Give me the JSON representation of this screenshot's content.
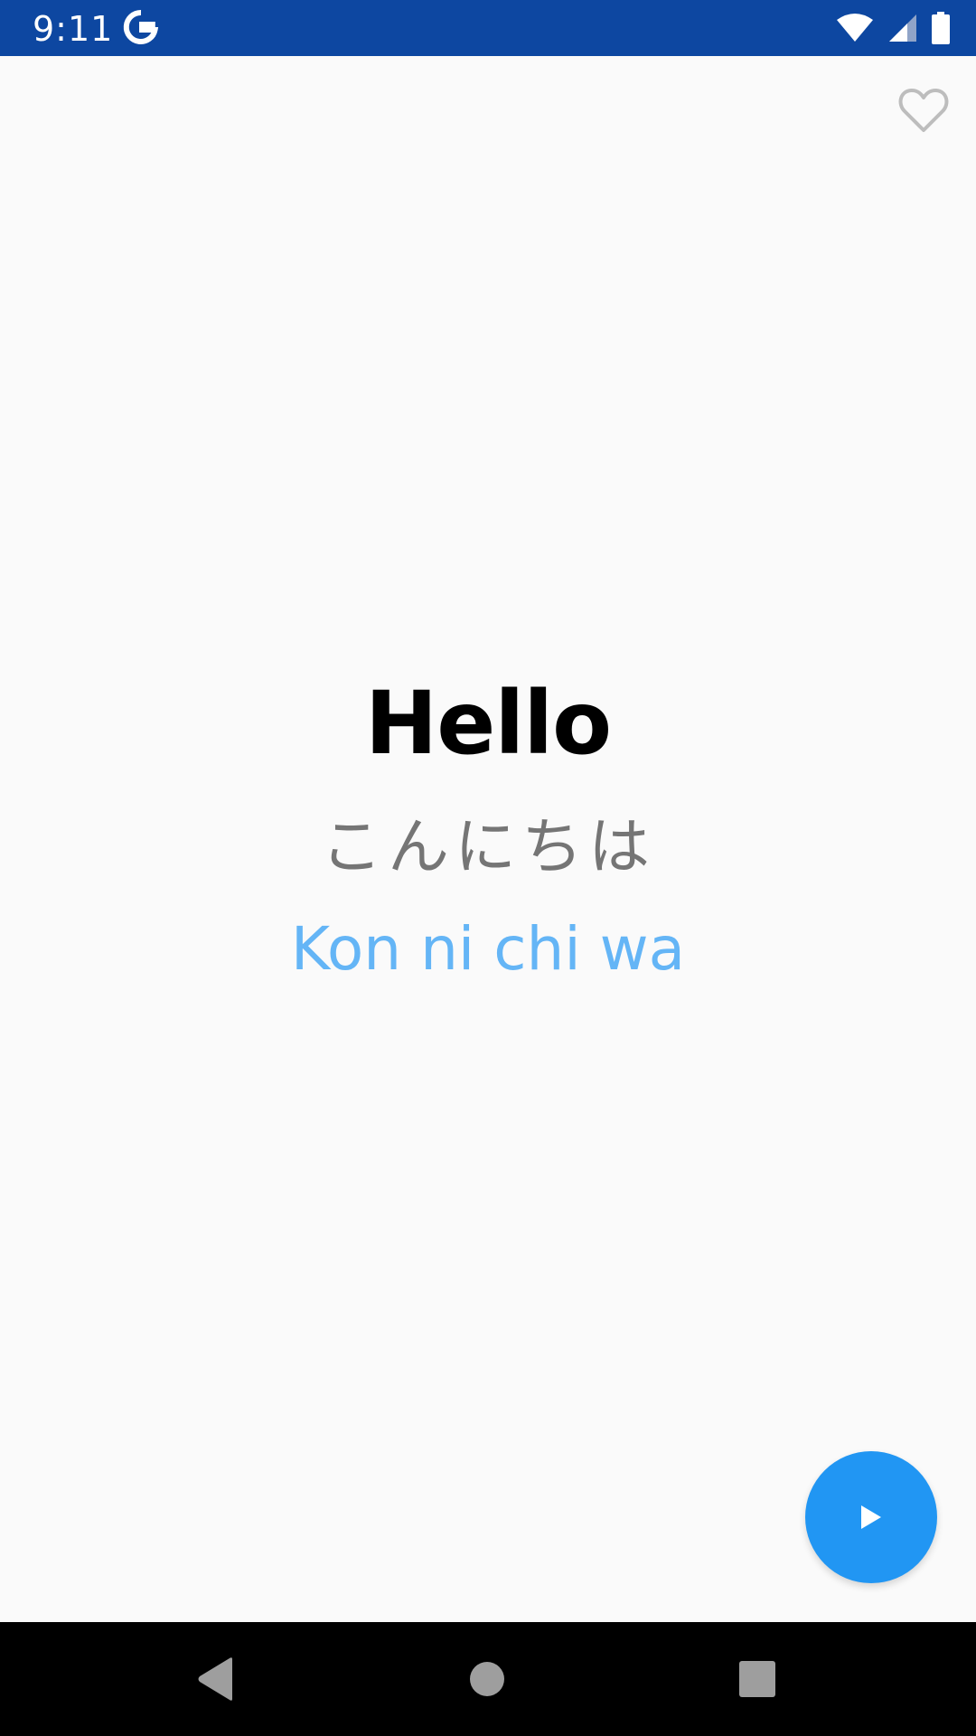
{
  "status_bar": {
    "time": "9:11",
    "background": "#0d47a1",
    "icons": [
      "google-icon",
      "wifi-icon",
      "cell-signal-icon",
      "battery-icon"
    ]
  },
  "card": {
    "english": "Hello",
    "native": "こんにちは",
    "romanization": "Kon ni chi wa"
  },
  "colors": {
    "accent": "#2196f3",
    "romanization": "#64b5f6",
    "native_text": "#757575",
    "favorite_outline": "#bdbdbd"
  },
  "actions": {
    "favorite_icon": "heart-outline-icon",
    "play_icon": "play-icon"
  },
  "nav_bar": {
    "icons": [
      "back-icon",
      "home-icon",
      "recents-icon"
    ]
  }
}
